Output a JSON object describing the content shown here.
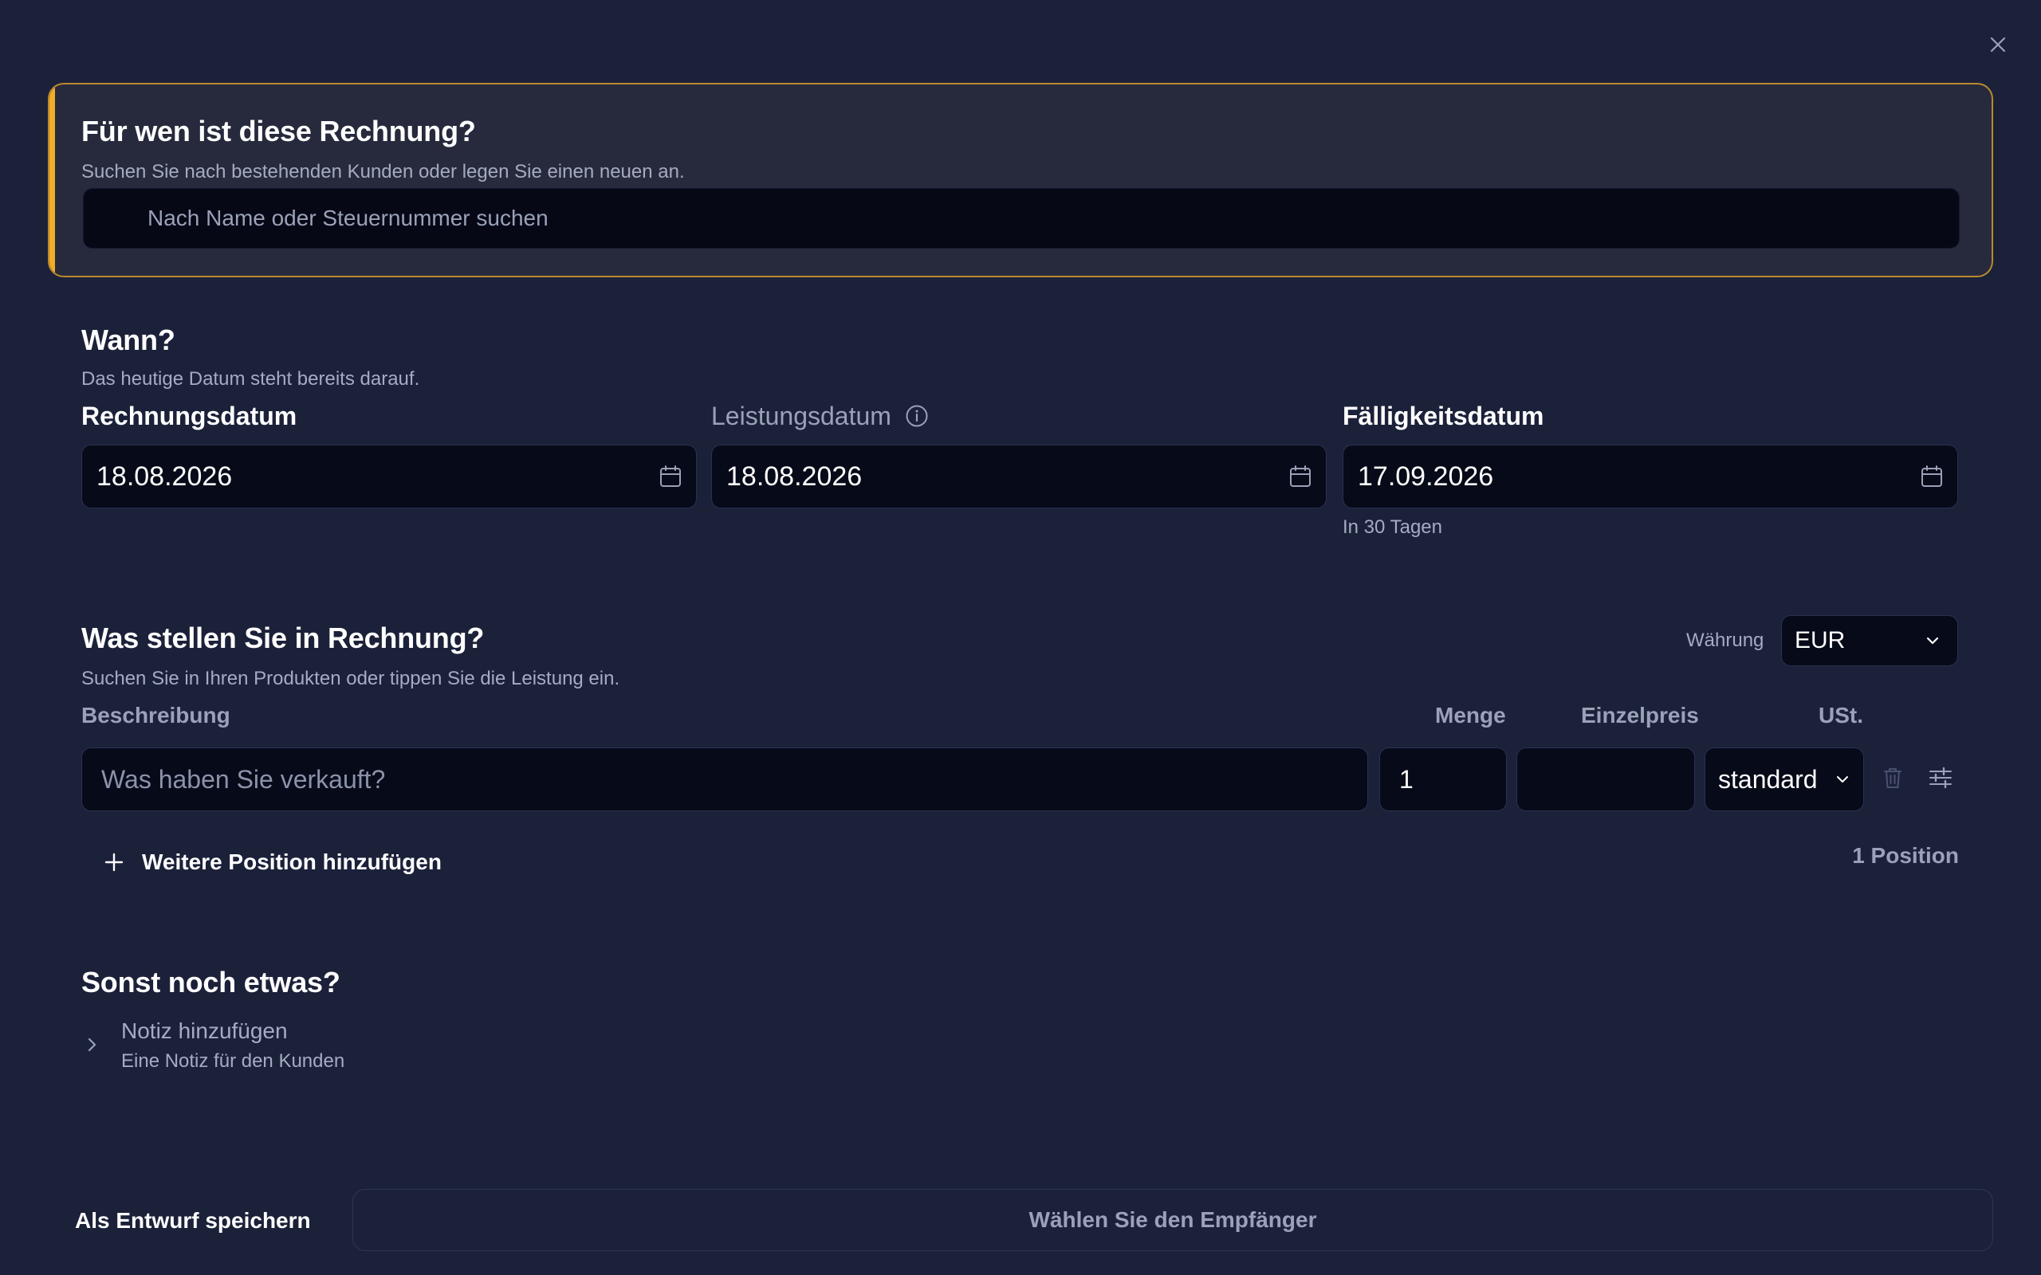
{
  "customer": {
    "title": "Für wen ist diese Rechnung?",
    "subtitle": "Suchen Sie nach bestehenden Kunden oder legen Sie einen neuen an.",
    "search_placeholder": "Nach Name oder Steuernummer suchen"
  },
  "dates": {
    "title": "Wann?",
    "subtitle": "Das heutige Datum steht bereits darauf.",
    "invoice_date": {
      "label": "Rechnungsdatum",
      "value": "18.08.2026"
    },
    "service_date": {
      "label": "Leistungsdatum",
      "value": "18.08.2026"
    },
    "due_date": {
      "label": "Fälligkeitsdatum",
      "value": "17.09.2026",
      "hint": "In 30 Tagen"
    }
  },
  "items": {
    "title": "Was stellen Sie in Rechnung?",
    "subtitle": "Suchen Sie in Ihren Produkten oder tippen Sie die Leistung ein.",
    "currency_label": "Währung",
    "currency_value": "EUR",
    "columns": {
      "description": "Beschreibung",
      "quantity": "Menge",
      "unit_price": "Einzelpreis",
      "vat": "USt."
    },
    "rows": [
      {
        "description_placeholder": "Was haben Sie verkauft?",
        "quantity": "1",
        "unit_price": "",
        "vat": "standard"
      }
    ],
    "add_label": "Weitere Position hinzufügen",
    "count_label": "1 Position"
  },
  "extras": {
    "title": "Sonst noch etwas?",
    "note_title": "Notiz hinzufügen",
    "note_subtitle": "Eine Notiz für den Kunden"
  },
  "footer": {
    "draft_label": "Als Entwurf speichern",
    "next_label": "Wählen Sie den Empfänger"
  },
  "colors": {
    "background": "#1c213a",
    "accent": "#f0ad2a",
    "accent_border": "#b98a2e",
    "input_bg": "#070a18",
    "muted_text": "#9aa1b8"
  }
}
